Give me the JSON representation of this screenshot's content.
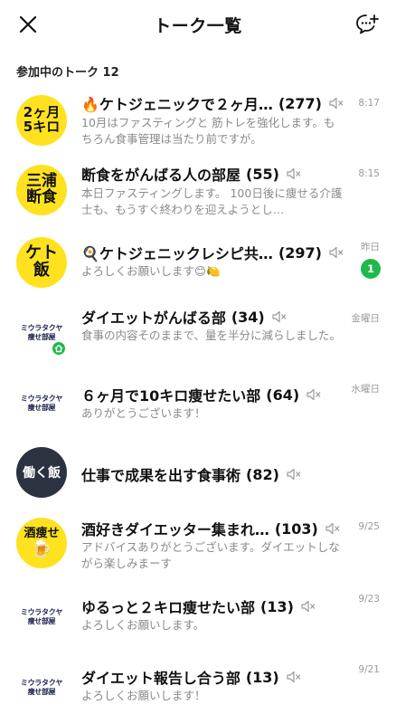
{
  "header": {
    "title": "トーク一覧",
    "close_icon": "close-icon",
    "new_chat_icon": "new-chat-icon"
  },
  "section": {
    "label": "参加中のトーク 12"
  },
  "chats": [
    {
      "avatar_text": "2ヶ月\n5キロ",
      "name": "🔥ケトジェニックで２ヶ月…",
      "count": "(277)",
      "preview": "10月はファスティングと 筋トレを強化します。もちろん食事管理は当たり前ですが。",
      "time": "8:17"
    },
    {
      "avatar_text": "三浦\n断食",
      "name": "断食をがんばる人の部屋",
      "count": "(55)",
      "preview": "本日ファスティングします。 100日後に痩せる介護士も、もうすぐ終わりを迎えようとし…",
      "time": "8:15"
    },
    {
      "avatar_text": "ケト\n飯",
      "name": "🍳ケトジェニックレシピ共…",
      "count": "(297)",
      "preview": "よろしくお願いします😊🍋",
      "time": "昨日",
      "unread": "1"
    },
    {
      "avatar_text": "ミウラタクヤ\n痩せ部屋",
      "name": "ダイエットがんばる部",
      "count": "(34)",
      "preview": "食事の内容そのままで、量を半分に減らしました。",
      "time": "金曜日"
    },
    {
      "avatar_text": "ミウラタクヤ\n痩せ部屋",
      "name": "６ヶ月で10キロ痩せたい部",
      "count": "(64)",
      "preview": "ありがとうございます！",
      "time": "水曜日"
    },
    {
      "avatar_text": "働く飯",
      "name": "仕事で成果を出す食事術",
      "count": "(82)",
      "preview": "",
      "time": ""
    },
    {
      "avatar_text": "酒痩せ",
      "name": "酒好きダイエッター集まれ…",
      "count": "(103)",
      "preview": "アドバイスありがとうございます。ダイエットしながら楽しみまーす",
      "time": "9/25"
    },
    {
      "avatar_text": "ミウラタクヤ\n痩せ部屋",
      "name": "ゆるっと２キロ痩せたい部",
      "count": "(13)",
      "preview": "よろしくお願いします。",
      "time": "9/23"
    },
    {
      "avatar_text": "ミウラタクヤ\n痩せ部屋",
      "name": "ダイエット報告し合う部",
      "count": "(13)",
      "preview": "よろしくお願いします！",
      "time": "9/21"
    }
  ],
  "colors": {
    "accent_green": "#1fb84a",
    "avatar_yellow": "#ffe21f"
  }
}
